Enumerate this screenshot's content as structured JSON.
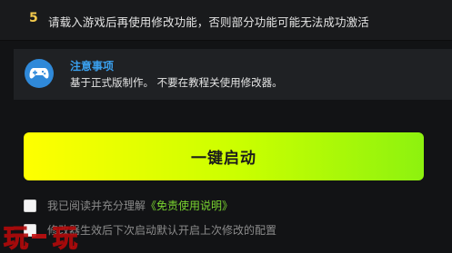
{
  "step": {
    "number": "5",
    "text": "请载入游戏后再使用修改功能，否则部分功能可能无法成功激活"
  },
  "notice": {
    "icon": "gamepad-icon",
    "title": "注意事项",
    "text": "基于正式版制作。 不要在教程关使用修改器。"
  },
  "launch": {
    "label": "一键启动"
  },
  "agreement": {
    "prefix": "我已阅读并充分理解",
    "link": "《免责使用说明》"
  },
  "restore": {
    "label": "修改器生效后下次启动默认开启上次修改的配置"
  },
  "watermark": {
    "text": "玩一玩"
  },
  "colors": {
    "accent_yellow": "#f2c94c",
    "notice_blue": "#3aa0ee",
    "link_green": "#79d330",
    "button_gradient_start": "#ffff00",
    "button_gradient_end": "#8df20f"
  }
}
